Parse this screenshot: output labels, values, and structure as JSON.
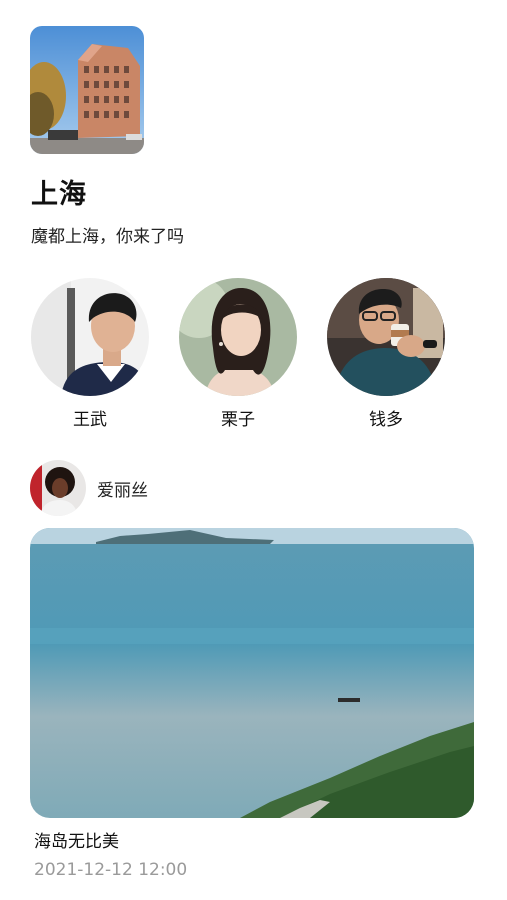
{
  "city": {
    "title": "上海",
    "description": "魔都上海，你来了吗"
  },
  "friends": [
    {
      "name": "王武"
    },
    {
      "name": "栗子"
    },
    {
      "name": "钱多"
    }
  ],
  "post": {
    "author": "爱丽丝",
    "caption": "海岛无比美",
    "time": "2021-12-12 12:00"
  }
}
